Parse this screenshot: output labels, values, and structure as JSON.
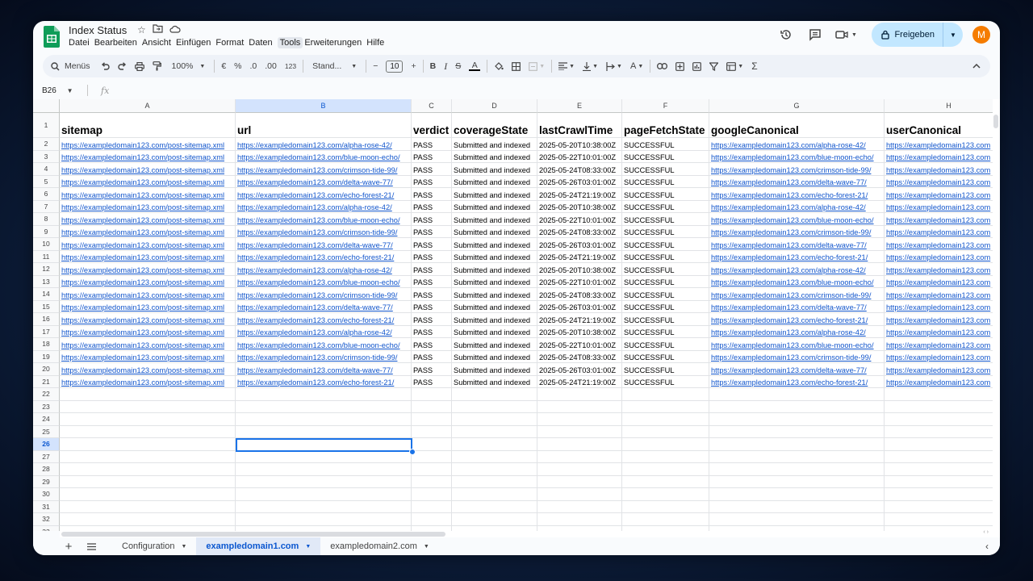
{
  "doc": {
    "title": "Index Status",
    "menu": [
      "Datei",
      "Bearbeiten",
      "Ansicht",
      "Einfügen",
      "Format",
      "Daten",
      "Tools",
      "Erweiterungen",
      "Hilfe"
    ],
    "active_menu": "Tools"
  },
  "topbar": {
    "share_label": "Freigeben",
    "avatar_letter": "M"
  },
  "toolbar": {
    "menus_label": "Menüs",
    "zoom": "100%",
    "currency": "€",
    "percent": "%",
    "dec_less": ".0",
    "dec_more": ".00",
    "number_format": "123",
    "font": "Stand...",
    "font_size": "10",
    "minus": "−",
    "plus": "+",
    "bold": "B",
    "italic": "I",
    "strike": "S",
    "text_color": "A",
    "sum": "Σ"
  },
  "formula": {
    "cell_ref": "B26",
    "fx": "fx",
    "value": ""
  },
  "grid": {
    "columns": [
      {
        "letter": "A"
      },
      {
        "letter": "B"
      },
      {
        "letter": "C"
      },
      {
        "letter": "D"
      },
      {
        "letter": "E"
      },
      {
        "letter": "F"
      },
      {
        "letter": "G"
      },
      {
        "letter": "H"
      }
    ],
    "selected_col": "B",
    "selected_row": 26,
    "header_row": [
      "sitemap",
      "url",
      "verdict",
      "coverageState",
      "lastCrawlTime",
      "pageFetchState",
      "googleCanonical",
      "userCanonical"
    ],
    "rows": [
      [
        "https://exampledomain123.com/post-sitemap.xml",
        "https://exampledomain123.com/alpha-rose-42/",
        "PASS",
        "Submitted and indexed",
        "2025-05-20T10:38:00Z",
        "SUCCESSFUL",
        "https://exampledomain123.com/alpha-rose-42/",
        "https://exampledomain123.com"
      ],
      [
        "https://exampledomain123.com/post-sitemap.xml",
        "https://exampledomain123.com/blue-moon-echo/",
        "PASS",
        "Submitted and indexed",
        "2025-05-22T10:01:00Z",
        "SUCCESSFUL",
        "https://exampledomain123.com/blue-moon-echo/",
        "https://exampledomain123.com"
      ],
      [
        "https://exampledomain123.com/post-sitemap.xml",
        "https://exampledomain123.com/crimson-tide-99/",
        "PASS",
        "Submitted and indexed",
        "2025-05-24T08:33:00Z",
        "SUCCESSFUL",
        "https://exampledomain123.com/crimson-tide-99/",
        "https://exampledomain123.com"
      ],
      [
        "https://exampledomain123.com/post-sitemap.xml",
        "https://exampledomain123.com/delta-wave-77/",
        "PASS",
        "Submitted and indexed",
        "2025-05-26T03:01:00Z",
        "SUCCESSFUL",
        "https://exampledomain123.com/delta-wave-77/",
        "https://exampledomain123.com"
      ],
      [
        "https://exampledomain123.com/post-sitemap.xml",
        "https://exampledomain123.com/echo-forest-21/",
        "PASS",
        "Submitted and indexed",
        "2025-05-24T21:19:00Z",
        "SUCCESSFUL",
        "https://exampledomain123.com/echo-forest-21/",
        "https://exampledomain123.com"
      ],
      [
        "https://exampledomain123.com/post-sitemap.xml",
        "https://exampledomain123.com/alpha-rose-42/",
        "PASS",
        "Submitted and indexed",
        "2025-05-20T10:38:00Z",
        "SUCCESSFUL",
        "https://exampledomain123.com/alpha-rose-42/",
        "https://exampledomain123.com"
      ],
      [
        "https://exampledomain123.com/post-sitemap.xml",
        "https://exampledomain123.com/blue-moon-echo/",
        "PASS",
        "Submitted and indexed",
        "2025-05-22T10:01:00Z",
        "SUCCESSFUL",
        "https://exampledomain123.com/blue-moon-echo/",
        "https://exampledomain123.com"
      ],
      [
        "https://exampledomain123.com/post-sitemap.xml",
        "https://exampledomain123.com/crimson-tide-99/",
        "PASS",
        "Submitted and indexed",
        "2025-05-24T08:33:00Z",
        "SUCCESSFUL",
        "https://exampledomain123.com/crimson-tide-99/",
        "https://exampledomain123.com"
      ],
      [
        "https://exampledomain123.com/post-sitemap.xml",
        "https://exampledomain123.com/delta-wave-77/",
        "PASS",
        "Submitted and indexed",
        "2025-05-26T03:01:00Z",
        "SUCCESSFUL",
        "https://exampledomain123.com/delta-wave-77/",
        "https://exampledomain123.com"
      ],
      [
        "https://exampledomain123.com/post-sitemap.xml",
        "https://exampledomain123.com/echo-forest-21/",
        "PASS",
        "Submitted and indexed",
        "2025-05-24T21:19:00Z",
        "SUCCESSFUL",
        "https://exampledomain123.com/echo-forest-21/",
        "https://exampledomain123.com"
      ],
      [
        "https://exampledomain123.com/post-sitemap.xml",
        "https://exampledomain123.com/alpha-rose-42/",
        "PASS",
        "Submitted and indexed",
        "2025-05-20T10:38:00Z",
        "SUCCESSFUL",
        "https://exampledomain123.com/alpha-rose-42/",
        "https://exampledomain123.com"
      ],
      [
        "https://exampledomain123.com/post-sitemap.xml",
        "https://exampledomain123.com/blue-moon-echo/",
        "PASS",
        "Submitted and indexed",
        "2025-05-22T10:01:00Z",
        "SUCCESSFUL",
        "https://exampledomain123.com/blue-moon-echo/",
        "https://exampledomain123.com"
      ],
      [
        "https://exampledomain123.com/post-sitemap.xml",
        "https://exampledomain123.com/crimson-tide-99/",
        "PASS",
        "Submitted and indexed",
        "2025-05-24T08:33:00Z",
        "SUCCESSFUL",
        "https://exampledomain123.com/crimson-tide-99/",
        "https://exampledomain123.com"
      ],
      [
        "https://exampledomain123.com/post-sitemap.xml",
        "https://exampledomain123.com/delta-wave-77/",
        "PASS",
        "Submitted and indexed",
        "2025-05-26T03:01:00Z",
        "SUCCESSFUL",
        "https://exampledomain123.com/delta-wave-77/",
        "https://exampledomain123.com"
      ],
      [
        "https://exampledomain123.com/post-sitemap.xml",
        "https://exampledomain123.com/echo-forest-21/",
        "PASS",
        "Submitted and indexed",
        "2025-05-24T21:19:00Z",
        "SUCCESSFUL",
        "https://exampledomain123.com/echo-forest-21/",
        "https://exampledomain123.com"
      ],
      [
        "https://exampledomain123.com/post-sitemap.xml",
        "https://exampledomain123.com/alpha-rose-42/",
        "PASS",
        "Submitted and indexed",
        "2025-05-20T10:38:00Z",
        "SUCCESSFUL",
        "https://exampledomain123.com/alpha-rose-42/",
        "https://exampledomain123.com"
      ],
      [
        "https://exampledomain123.com/post-sitemap.xml",
        "https://exampledomain123.com/blue-moon-echo/",
        "PASS",
        "Submitted and indexed",
        "2025-05-22T10:01:00Z",
        "SUCCESSFUL",
        "https://exampledomain123.com/blue-moon-echo/",
        "https://exampledomain123.com"
      ],
      [
        "https://exampledomain123.com/post-sitemap.xml",
        "https://exampledomain123.com/crimson-tide-99/",
        "PASS",
        "Submitted and indexed",
        "2025-05-24T08:33:00Z",
        "SUCCESSFUL",
        "https://exampledomain123.com/crimson-tide-99/",
        "https://exampledomain123.com"
      ],
      [
        "https://exampledomain123.com/post-sitemap.xml",
        "https://exampledomain123.com/delta-wave-77/",
        "PASS",
        "Submitted and indexed",
        "2025-05-26T03:01:00Z",
        "SUCCESSFUL",
        "https://exampledomain123.com/delta-wave-77/",
        "https://exampledomain123.com"
      ],
      [
        "https://exampledomain123.com/post-sitemap.xml",
        "https://exampledomain123.com/echo-forest-21/",
        "PASS",
        "Submitted and indexed",
        "2025-05-24T21:19:00Z",
        "SUCCESSFUL",
        "https://exampledomain123.com/echo-forest-21/",
        "https://exampledomain123.com"
      ]
    ],
    "link_columns": [
      0,
      1,
      6,
      7
    ],
    "row_numbers": [
      1,
      2,
      3,
      4,
      5,
      6,
      7,
      8,
      9,
      10,
      11,
      12,
      13,
      14,
      15,
      16,
      17,
      18,
      19,
      20,
      21,
      22,
      23,
      24,
      25,
      26,
      27,
      28,
      29,
      30,
      31,
      32,
      33
    ]
  },
  "sheets": {
    "tabs": [
      "Configuration",
      "exampledomain1.com",
      "exampledomain2.com"
    ],
    "active": "exampledomain1.com"
  },
  "colors": {
    "link": "#1155cc",
    "accent": "#1a73e8",
    "share_bg": "#c2e7ff",
    "avatar": "#f57c00",
    "sheets_green": "#0f9d58"
  }
}
